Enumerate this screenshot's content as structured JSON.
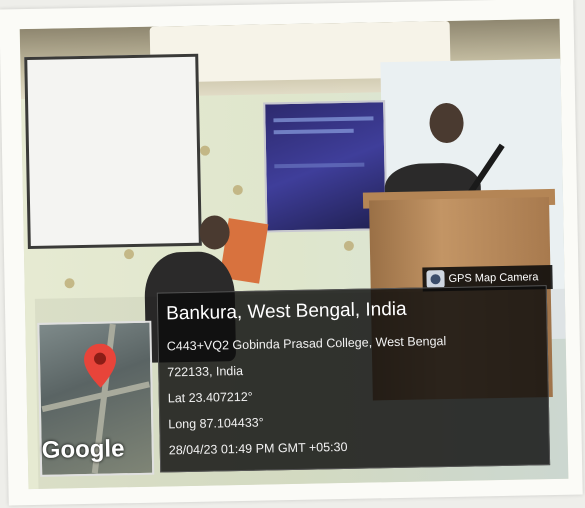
{
  "gps_tag": {
    "label": "GPS Map Camera",
    "icon": "camera-icon"
  },
  "map": {
    "provider_logo": "Google",
    "pin_icon": "map-pin-icon",
    "pin_color": "#e8443a"
  },
  "location": {
    "place": "Bankura, West Bengal, India",
    "address": "C443+VQ2 Gobinda Prasad College, West Bengal",
    "postal": "722133, India",
    "lat": "Lat 23.407212°",
    "long": "Long 87.104433°",
    "timestamp": "28/04/23 01:49 PM GMT +05:30"
  }
}
